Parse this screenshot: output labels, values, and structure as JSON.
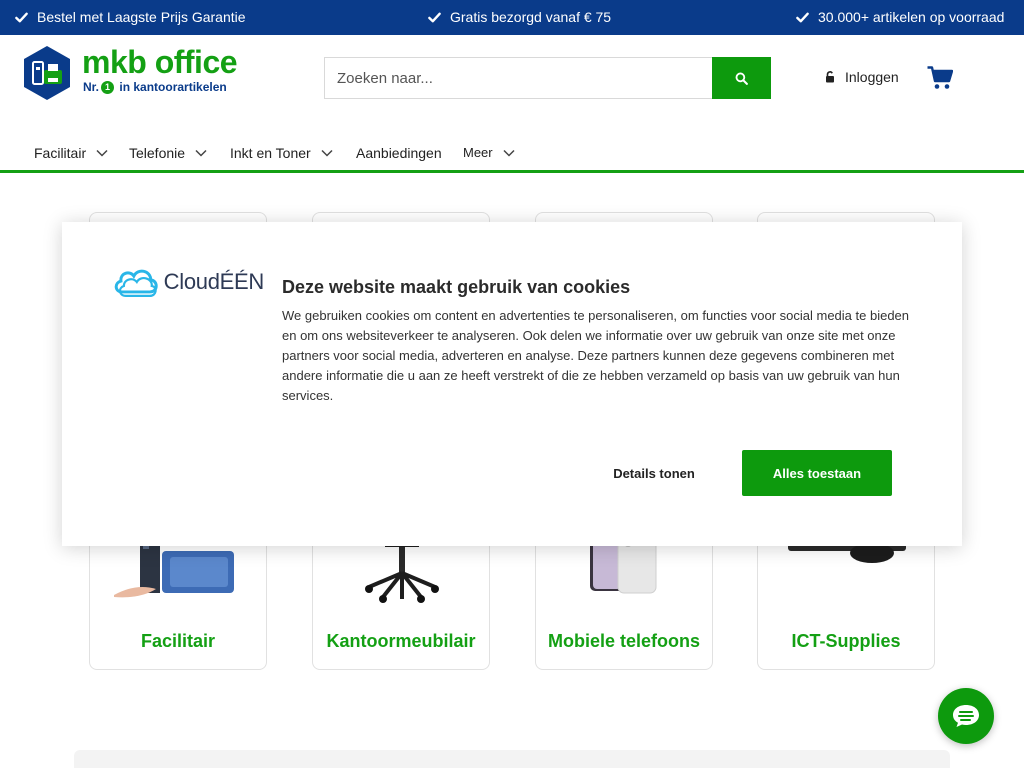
{
  "colors": {
    "brand_blue": "#0a3b8a",
    "brand_green": "#14a014",
    "button_green": "#0d9a0d"
  },
  "usp_bar": {
    "items": [
      "Bestel met Laagste Prijs Garantie",
      "Gratis bezorgd vanaf € 75",
      "30.000+ artikelen op voorraad"
    ],
    "icon": "check-icon"
  },
  "header": {
    "logo": {
      "name": "mkb office",
      "tag_pre": "Nr.",
      "tag_num": "1",
      "tag_post": "in kantoorartikelen"
    },
    "search": {
      "placeholder": "Zoeken naar...",
      "button_icon": "search-icon"
    },
    "login_label": "Inloggen",
    "login_icon": "lock-icon",
    "cart_icon": "cart-icon"
  },
  "nav": {
    "items": [
      {
        "label": "Facilitair",
        "has_dropdown": true
      },
      {
        "label": "Telefonie",
        "has_dropdown": true
      },
      {
        "label": "Inkt en Toner",
        "has_dropdown": true
      },
      {
        "label": "Aanbiedingen",
        "has_dropdown": false
      },
      {
        "label": "Meer",
        "has_dropdown": true
      }
    ]
  },
  "categories": [
    {
      "title": "Facilitair"
    },
    {
      "title": "Kantoormeubilair"
    },
    {
      "title": "Mobiele telefoons"
    },
    {
      "title": "ICT-Supplies"
    }
  ],
  "cookie_banner": {
    "brand": "CloudÉÉN",
    "title": "Deze website maakt gebruik van cookies",
    "body": "We gebruiken cookies om content en advertenties te personaliseren, om functies voor social media te bieden en om ons websiteverkeer te analyseren. Ook delen we informatie over uw gebruik van onze site met onze partners voor social media, adverteren en analyse. Deze partners kunnen deze gegevens combineren met andere informatie die u aan ze heeft verstrekt of die ze hebben verzameld op basis van uw gebruik van hun services.",
    "details_button": "Details tonen",
    "allow_button": "Alles toestaan"
  },
  "chat": {
    "icon": "chat-icon"
  }
}
